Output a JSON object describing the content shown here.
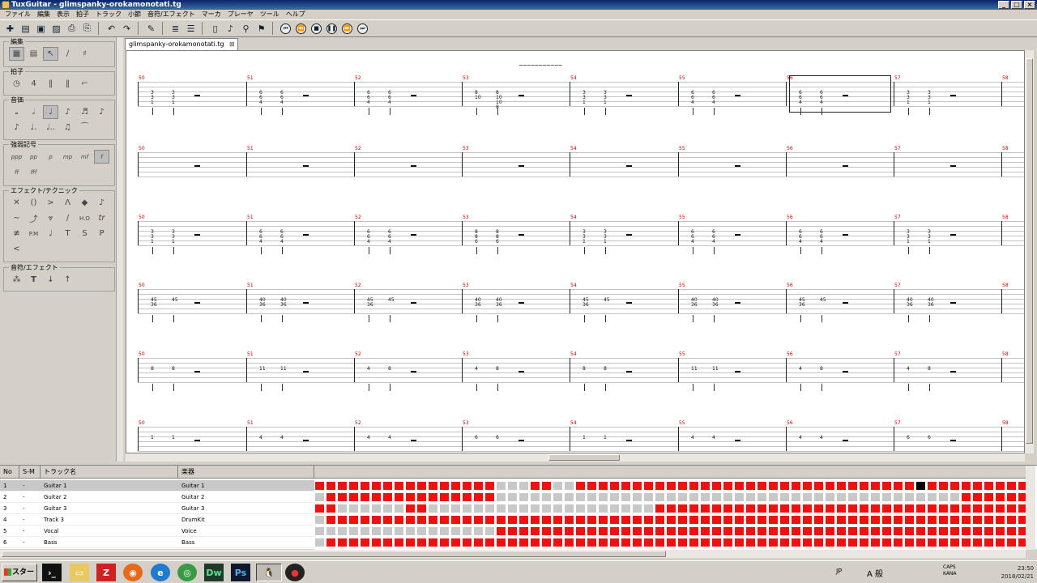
{
  "window": {
    "title": "TuxGuitar - glimspanky-orokamonotati.tg"
  },
  "menu": [
    "ファイル",
    "編集",
    "表示",
    "拍子",
    "トラック",
    "小節",
    "音符/エフェクト",
    "マーカ",
    "プレーヤ",
    "ツール",
    "ヘルプ"
  ],
  "palette": {
    "edit": {
      "title": "編集"
    },
    "time": {
      "title": "拍子"
    },
    "duration": {
      "title": "音価"
    },
    "dynamics": {
      "title": "強弱記号",
      "items": [
        "ppp",
        "pp",
        "p",
        "mp",
        "mf",
        "f",
        "ff",
        "fff"
      ]
    },
    "effects": {
      "title": "エフェクト/テクニック",
      "items": [
        "H.O",
        "tr",
        "P.M",
        "T",
        "S",
        "P"
      ]
    },
    "note_effects": {
      "title": "音符/エフェクト"
    }
  },
  "tab": {
    "label": "glimspanky-orokamonotati.tg"
  },
  "score": {
    "measures": [
      "50",
      "51",
      "52",
      "53",
      "54",
      "55",
      "56",
      "57",
      "58"
    ],
    "text_marker": "~~~~~~~~~~~"
  },
  "tracks": {
    "headers": {
      "no": "No",
      "sm": "S-M",
      "name": "トラック名",
      "instrument": "楽器"
    },
    "rows": [
      {
        "no": "1",
        "sm": "-",
        "name": "Guitar 1",
        "instrument": "Guitar 1"
      },
      {
        "no": "2",
        "sm": "-",
        "name": "Guitar 2",
        "instrument": "Guitar 2"
      },
      {
        "no": "3",
        "sm": "-",
        "name": "Guitar 3",
        "instrument": "Guitar 3"
      },
      {
        "no": "4",
        "sm": "-",
        "name": "Track 3",
        "instrument": "DrumKit"
      },
      {
        "no": "5",
        "sm": "-",
        "name": "Vocal",
        "instrument": "Voice"
      },
      {
        "no": "6",
        "sm": "-",
        "name": "Bass",
        "instrument": "Bass"
      }
    ]
  },
  "taskbar": {
    "start": "スタート",
    "tray": {
      "lang": "JP",
      "ime": "A 般",
      "caps": "CAPS",
      "kana": "KANA"
    },
    "time": "23:50",
    "date": "2018/02/21"
  },
  "colors": {
    "filled": "#ee1111",
    "empty": "#c8c8c8",
    "current": "#000000"
  }
}
